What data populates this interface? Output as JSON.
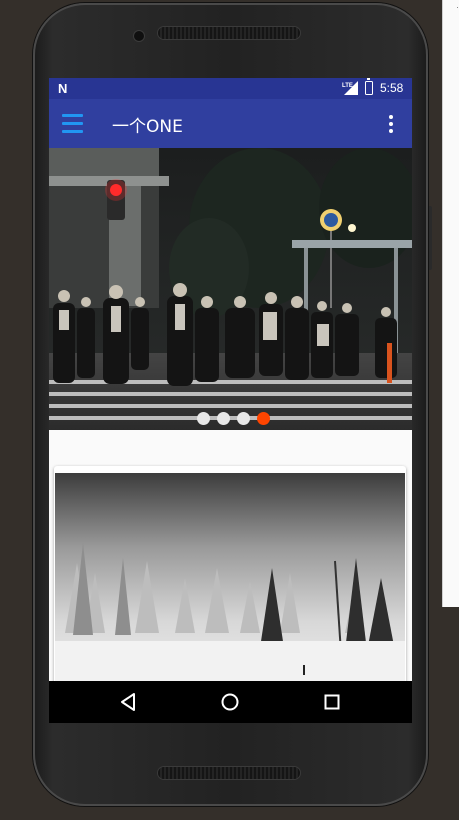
{
  "status_bar": {
    "notification_icon": "N",
    "network_label": "LTE",
    "battery_label": "⚡",
    "time": "5:58",
    "background_color": "#283593"
  },
  "app_bar": {
    "title": "一个ONE",
    "menu_icon": "hamburger-menu-icon",
    "overflow_icon": "more-vert-icon",
    "background_color": "#303f9f",
    "menu_icon_color": "#2196f3"
  },
  "banner": {
    "image_description_icon": "city-crosswalk-photo",
    "page_count": 4,
    "active_page": 4,
    "active_dot_color": "#ff4500",
    "inactive_dot_color": "#e8e8e8"
  },
  "card": {
    "image_icon": "snowy-forest-photo"
  },
  "nav_bar": {
    "back_icon": "back-triangle-icon",
    "home_icon": "home-circle-icon",
    "recents_icon": "recents-square-icon"
  }
}
